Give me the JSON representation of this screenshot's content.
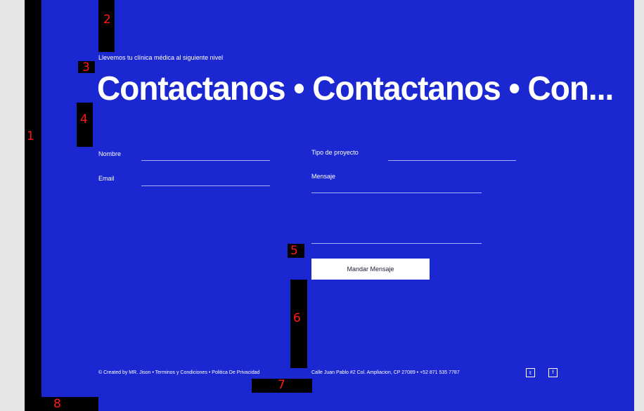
{
  "hero": {
    "subtitle": "Llevemos tu clínica médica al siguiente nivel",
    "headline": "Contactanos • Contactanos • Con..."
  },
  "form": {
    "nombre_label": "Nombre",
    "email_label": "Email",
    "tipo_label": "Tipo de proyecto",
    "mensaje_label": "Mensaje",
    "submit_label": "Mandar Mensaje"
  },
  "footer": {
    "copyright_symbol": "©",
    "credits": "Created by MR. Jison • Terminos y Condiciones • Politica De Privacidad",
    "address": "Calle Juan Pablo #2 Col. Ampliacion, CP 27089 • +52 871 535 7787",
    "twitter_glyph": "𝕥",
    "facebook_glyph": "f"
  },
  "markers": [
    "1",
    "2",
    "3",
    "4",
    "5",
    "6",
    "7",
    "8"
  ],
  "colors": {
    "background": "#1b27d0",
    "outer": "#e6e6e6",
    "text": "#ffffff",
    "marker": "#ff1a1a"
  }
}
